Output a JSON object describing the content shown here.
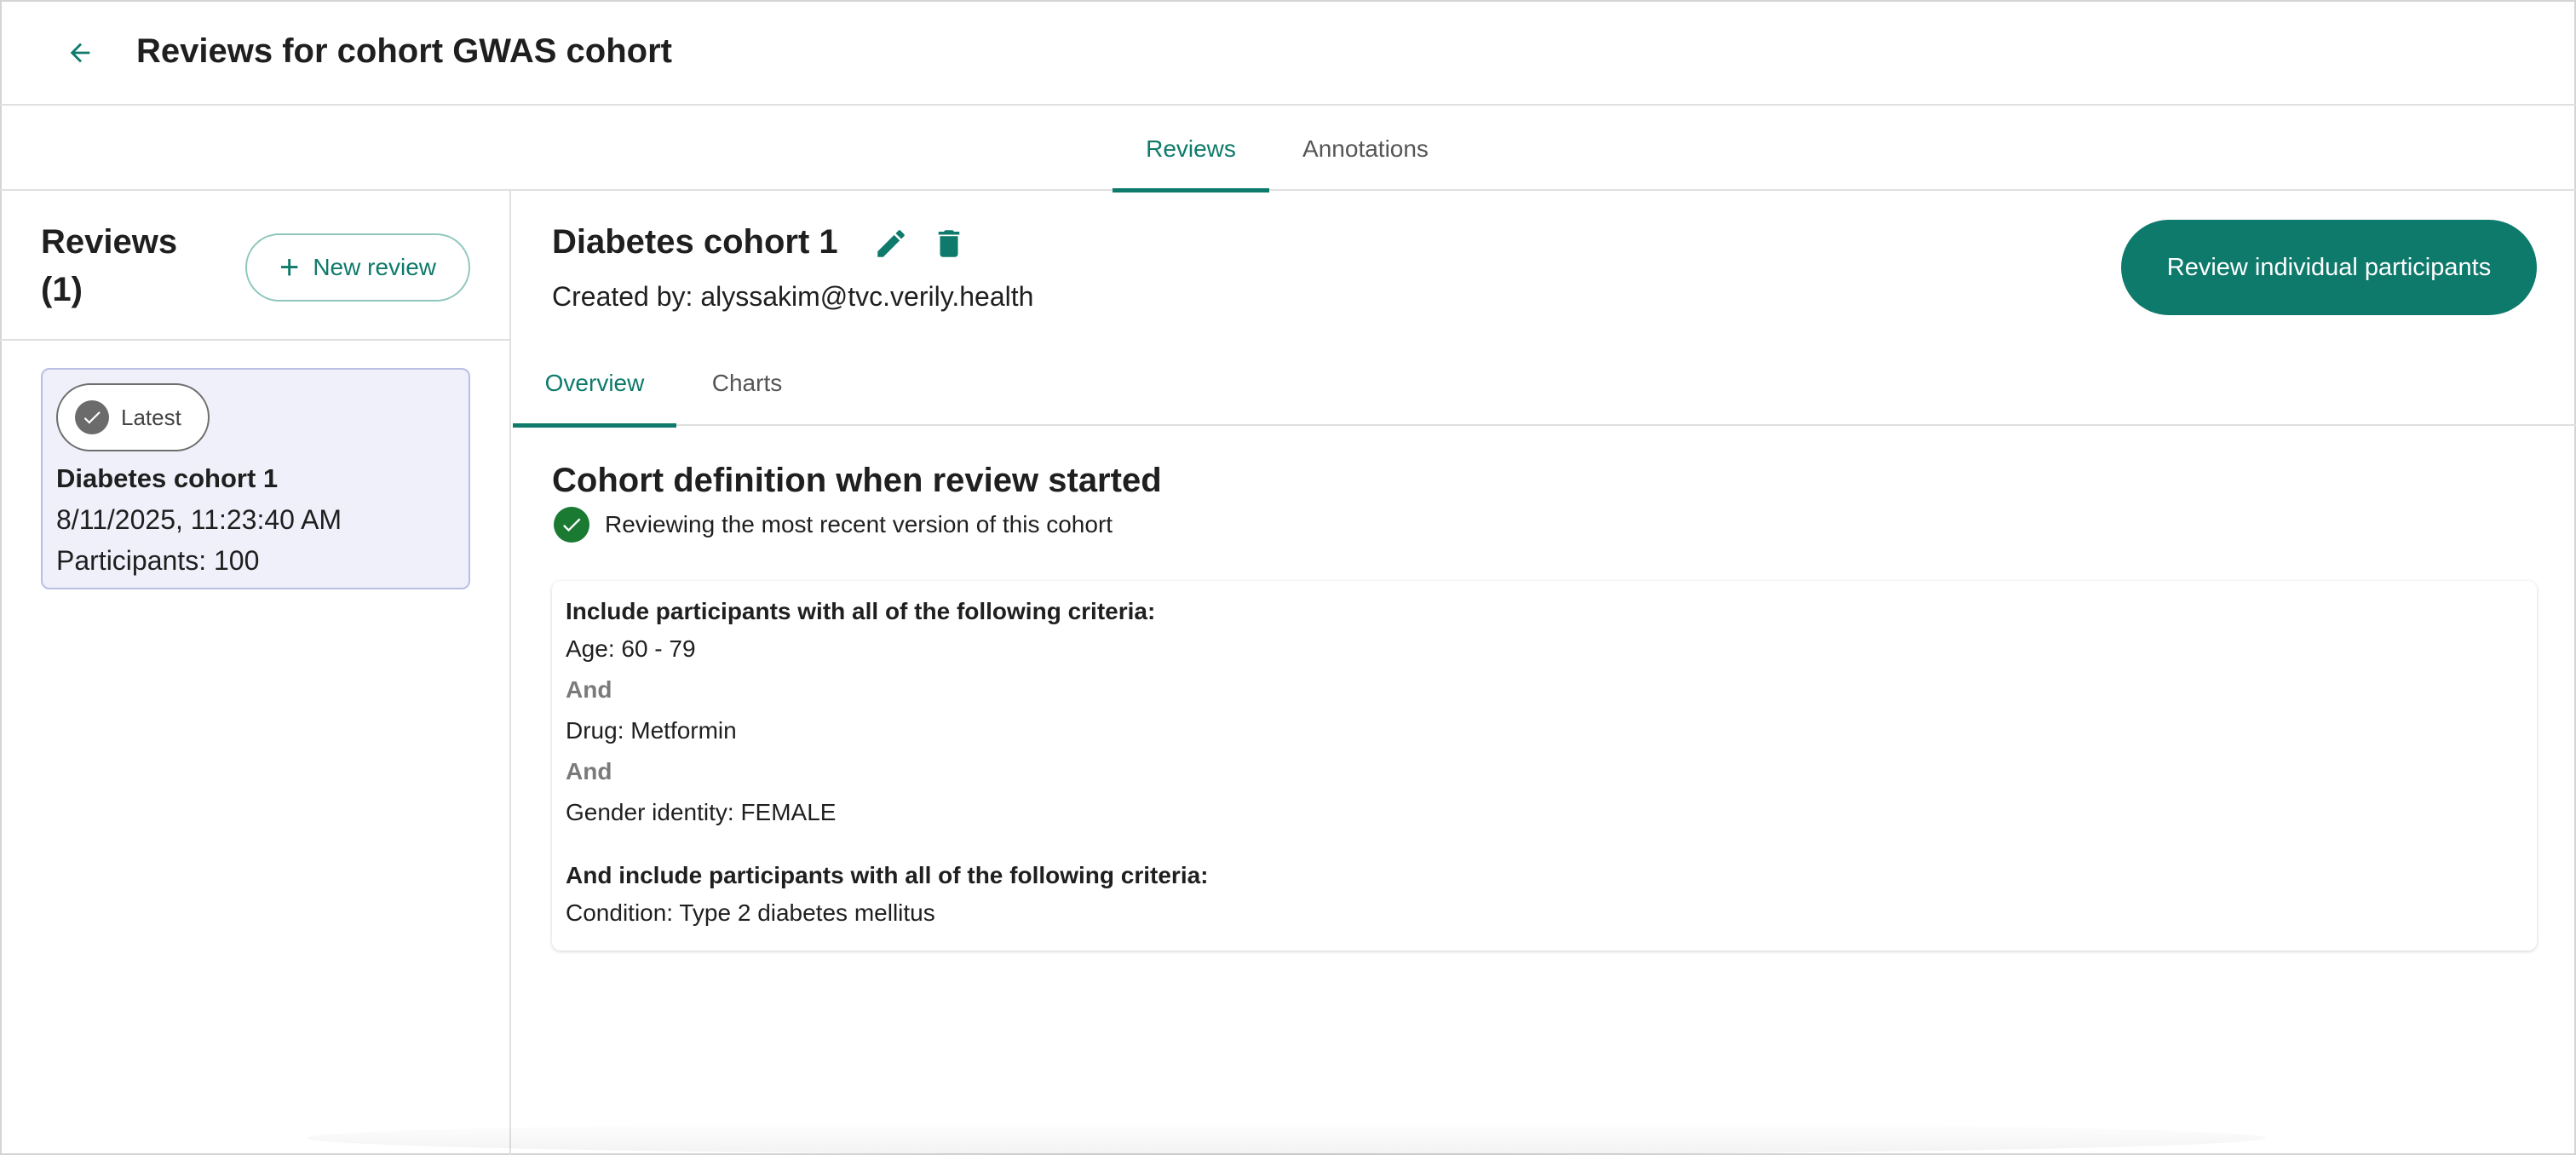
{
  "header": {
    "title": "Reviews for cohort GWAS cohort",
    "back_icon": "arrow-left-icon"
  },
  "main_tabs": [
    {
      "label": "Reviews",
      "active": true
    },
    {
      "label": "Annotations",
      "active": false
    }
  ],
  "sidebar": {
    "title": "Reviews (1)",
    "new_review_label": "New review",
    "reviews": [
      {
        "badge": "Latest",
        "name": "Diabetes cohort 1",
        "date": "8/11/2025, 11:23:40 AM",
        "participants": "Participants: 100"
      }
    ]
  },
  "detail": {
    "name": "Diabetes cohort 1",
    "created_by": "Created by: alyssakim@tvc.verily.health",
    "action_label": "Review individual participants",
    "tabs": [
      {
        "label": "Overview",
        "active": true
      },
      {
        "label": "Charts",
        "active": false
      }
    ],
    "section_title": "Cohort definition when review started",
    "status_text": "Reviewing the most recent version of this cohort",
    "criteria": {
      "group1_heading": "Include participants with all of the following criteria:",
      "group1_items": [
        "Age: 60 - 79",
        "Drug: Metformin",
        "Gender identity: FEMALE"
      ],
      "operator": "And",
      "group2_heading": "And include participants with all of the following criteria:",
      "group2_items": [
        "Condition: Type 2 diabetes mellitus"
      ]
    }
  },
  "colors": {
    "accent": "#0e7a6b",
    "success": "#1a7a32",
    "selected_card_bg": "#eff0fa",
    "selected_card_border": "#b9bfe3"
  }
}
